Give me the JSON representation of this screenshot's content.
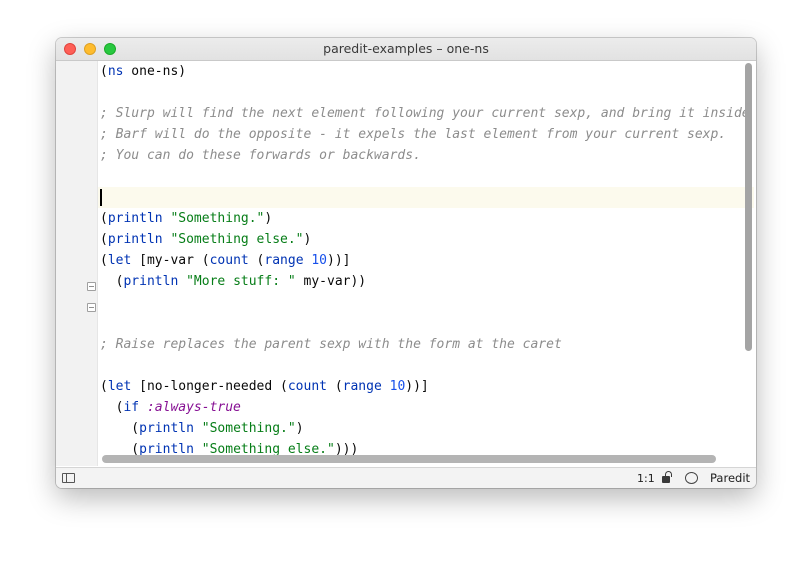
{
  "window": {
    "title": "paredit-examples – one-ns"
  },
  "code_lines": [
    [
      {
        "t": "(",
        "c": ""
      },
      {
        "t": "ns",
        "c": "fn"
      },
      {
        "t": " one-ns)",
        "c": ""
      }
    ],
    [],
    [
      {
        "t": "; Slurp will find the next element following your current sexp, and bring it inside",
        "c": "cm"
      }
    ],
    [
      {
        "t": "; Barf will do the opposite - it expels the last element from your current sexp.",
        "c": "cm"
      }
    ],
    [
      {
        "t": "; You can do these forwards or backwards.",
        "c": "cm"
      }
    ],
    [],
    [],
    [
      {
        "t": "(",
        "c": ""
      },
      {
        "t": "println",
        "c": "fn"
      },
      {
        "t": " ",
        "c": ""
      },
      {
        "t": "\"Something.\"",
        "c": "str"
      },
      {
        "t": ")",
        "c": ""
      }
    ],
    [
      {
        "t": "(",
        "c": ""
      },
      {
        "t": "println",
        "c": "fn"
      },
      {
        "t": " ",
        "c": ""
      },
      {
        "t": "\"Something else.\"",
        "c": "str"
      },
      {
        "t": ")",
        "c": ""
      }
    ],
    [
      {
        "t": "(",
        "c": ""
      },
      {
        "t": "let",
        "c": "fn"
      },
      {
        "t": " [my-var (",
        "c": ""
      },
      {
        "t": "count",
        "c": "fn"
      },
      {
        "t": " (",
        "c": ""
      },
      {
        "t": "range",
        "c": "fn"
      },
      {
        "t": " ",
        "c": ""
      },
      {
        "t": "10",
        "c": "num"
      },
      {
        "t": "))]",
        "c": ""
      }
    ],
    [
      {
        "t": "  (",
        "c": ""
      },
      {
        "t": "println",
        "c": "fn"
      },
      {
        "t": " ",
        "c": ""
      },
      {
        "t": "\"More stuff: \"",
        "c": "str"
      },
      {
        "t": " my-var))",
        "c": ""
      }
    ],
    [],
    [],
    [
      {
        "t": "; Raise replaces the parent sexp with the form at the caret",
        "c": "cm"
      }
    ],
    [],
    [
      {
        "t": "(",
        "c": ""
      },
      {
        "t": "let",
        "c": "fn"
      },
      {
        "t": " [no-longer-needed (",
        "c": ""
      },
      {
        "t": "count",
        "c": "fn"
      },
      {
        "t": " (",
        "c": ""
      },
      {
        "t": "range",
        "c": "fn"
      },
      {
        "t": " ",
        "c": ""
      },
      {
        "t": "10",
        "c": "num"
      },
      {
        "t": "))]",
        "c": ""
      }
    ],
    [
      {
        "t": "  (",
        "c": ""
      },
      {
        "t": "if",
        "c": "fn"
      },
      {
        "t": " ",
        "c": ""
      },
      {
        "t": ":always-true",
        "c": "kw"
      }
    ],
    [
      {
        "t": "    (",
        "c": ""
      },
      {
        "t": "println",
        "c": "fn"
      },
      {
        "t": " ",
        "c": ""
      },
      {
        "t": "\"Something.\"",
        "c": "str"
      },
      {
        "t": ")",
        "c": ""
      }
    ],
    [
      {
        "t": "    (",
        "c": ""
      },
      {
        "t": "println",
        "c": "fn"
      },
      {
        "t": " ",
        "c": ""
      },
      {
        "t": "\"Something else.\"",
        "c": "str"
      },
      {
        "t": ")))",
        "c": ""
      }
    ]
  ],
  "status_bar": {
    "position": "1:1",
    "mode": "Paredit"
  },
  "icons": {
    "panel": "panel-toggle-icon",
    "lock": "unlock-icon",
    "bubble": "speech-bubble-icon"
  },
  "colors": {
    "function": "#0033b3",
    "string": "#067d17",
    "number": "#1750eb",
    "keyword": "#871094",
    "comment": "#8c8c8c",
    "current_line": "#fcfaed"
  }
}
